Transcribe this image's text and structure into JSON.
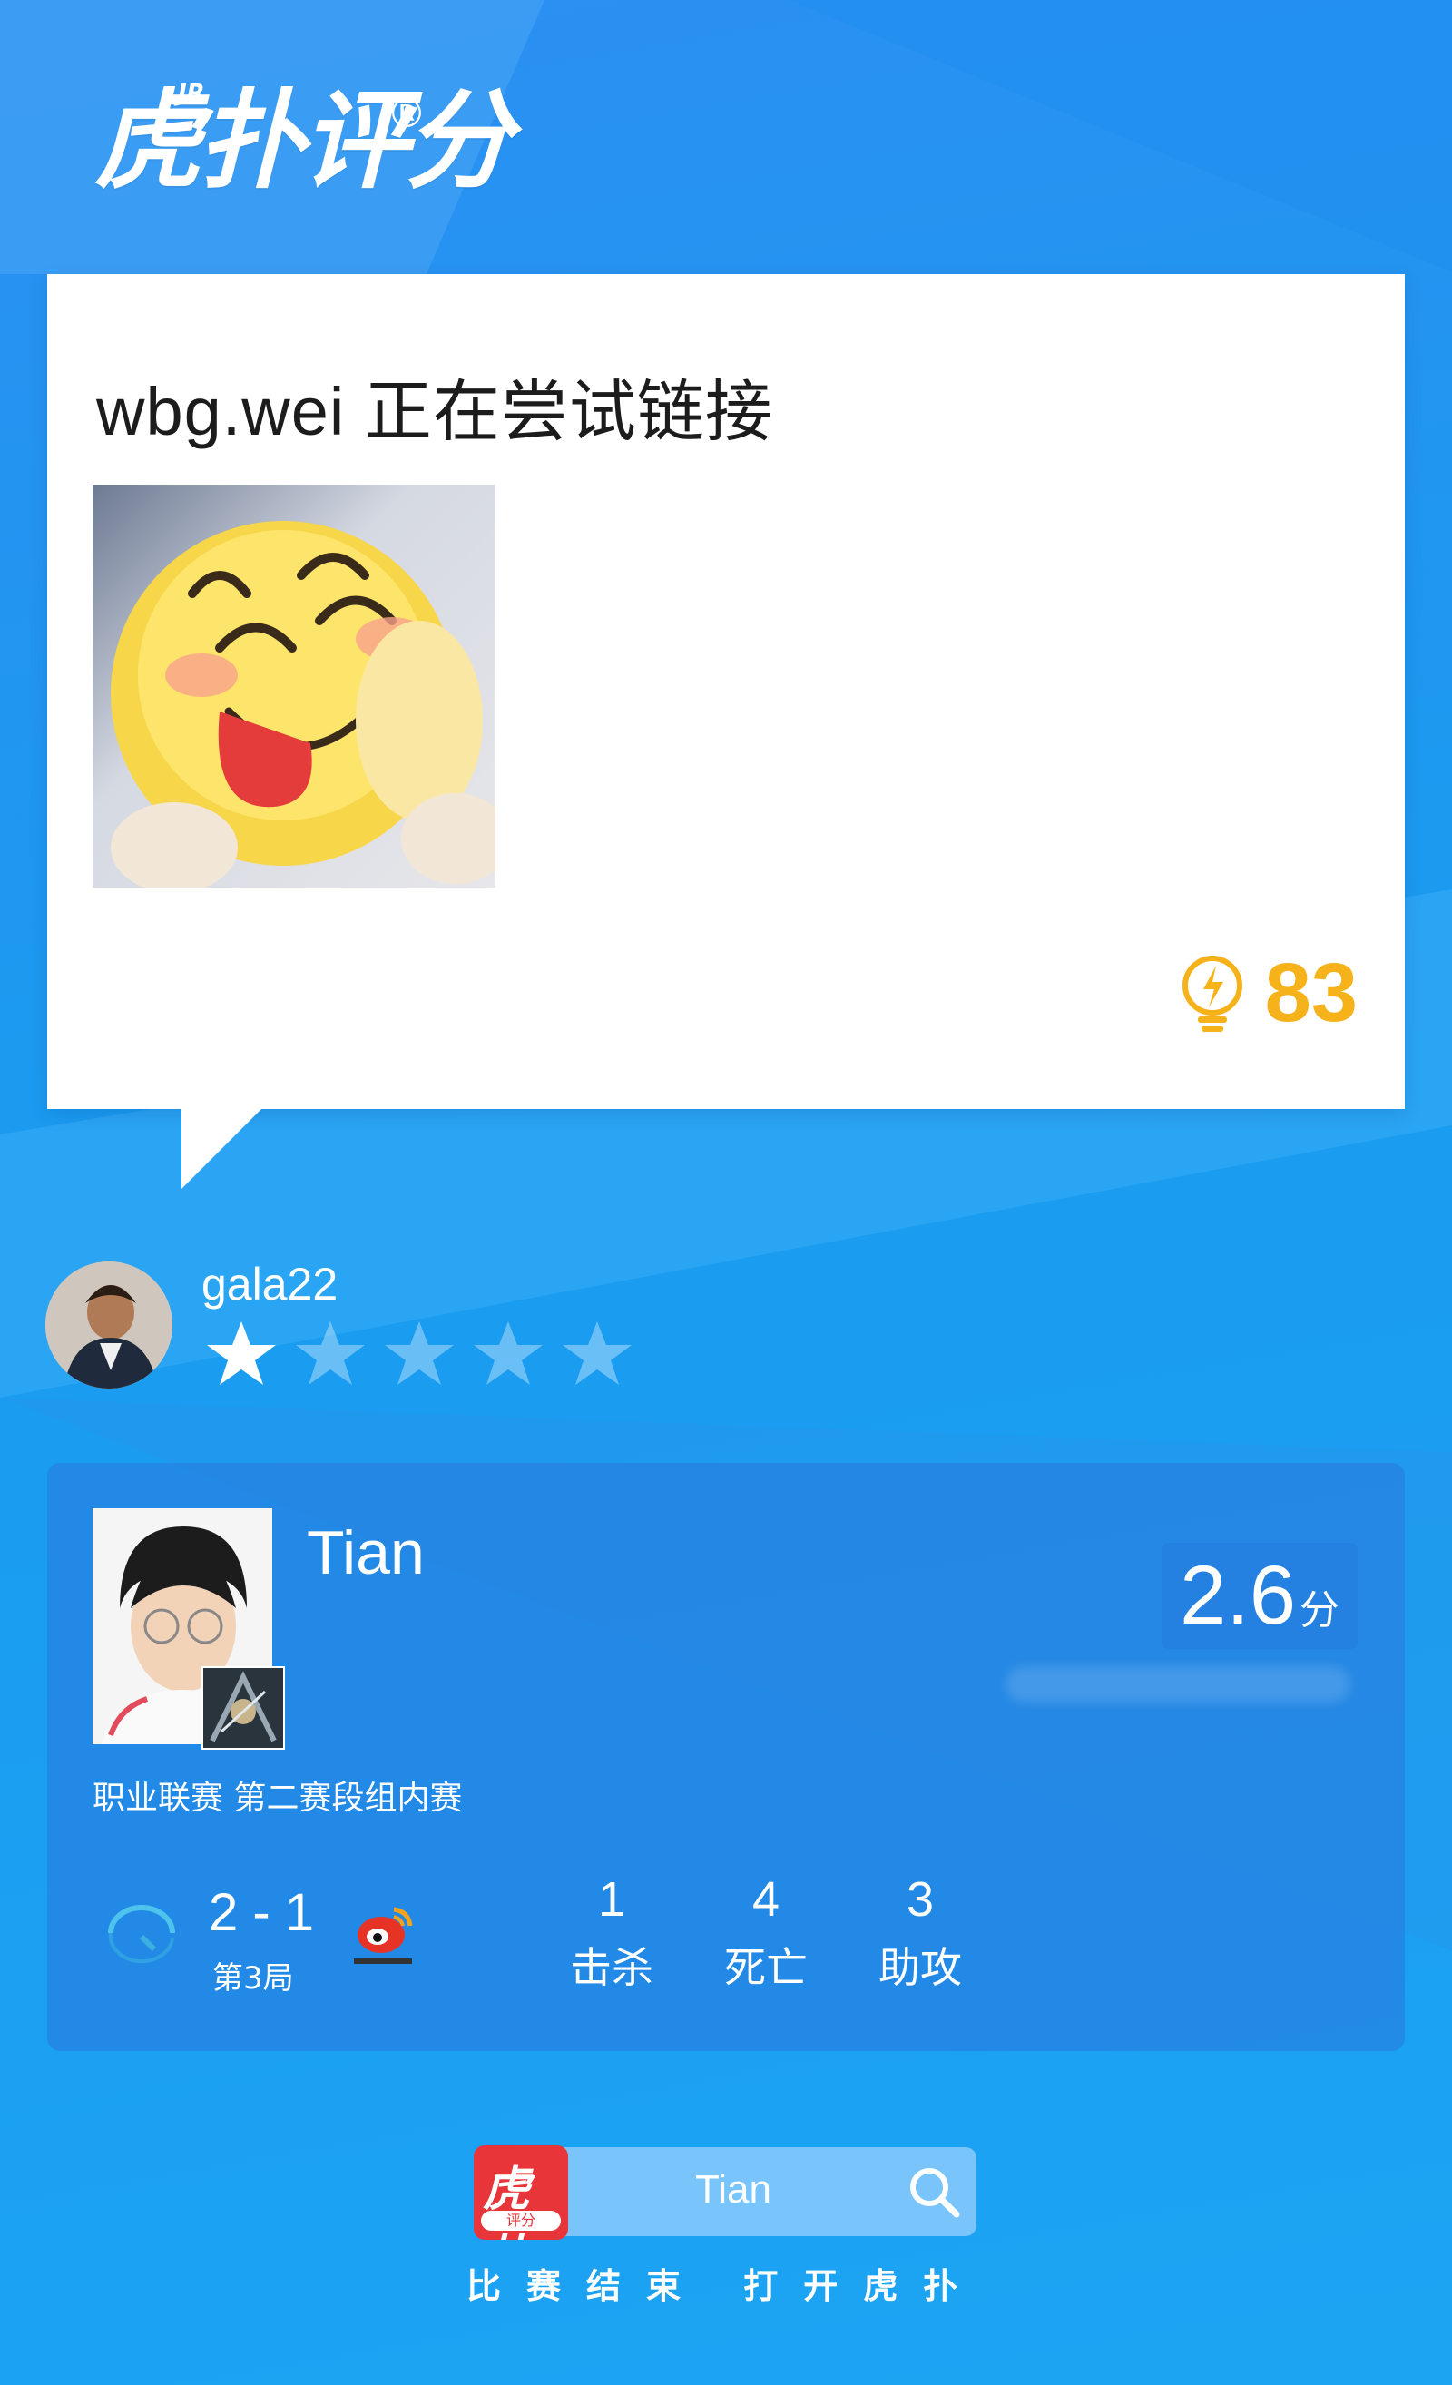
{
  "logo": {
    "text": "虎扑评分",
    "jr": "JR",
    "reg": "®"
  },
  "post": {
    "title": "wbg.wei 正在尝试链接",
    "likes": "83"
  },
  "reviewer": {
    "username": "gala22",
    "rating": 1,
    "max_rating": 5
  },
  "player": {
    "name": "Tian",
    "score": "2.6",
    "score_unit": "分",
    "league": "职业联赛 第二赛段组内赛",
    "match_score": "2 - 1",
    "round": "第3局",
    "stats": [
      {
        "value": "1",
        "label": "击杀"
      },
      {
        "value": "4",
        "label": "死亡"
      },
      {
        "value": "3",
        "label": "助攻"
      }
    ]
  },
  "footer": {
    "app_icon_text": "虎扑",
    "app_icon_sub": "评分",
    "search_text": "Tian",
    "caption": "比赛结束 打开虎扑"
  },
  "colors": {
    "accent_gold": "#f6b21a",
    "bg_blue": "#1a9bf0",
    "hupu_red": "#e8353a"
  }
}
